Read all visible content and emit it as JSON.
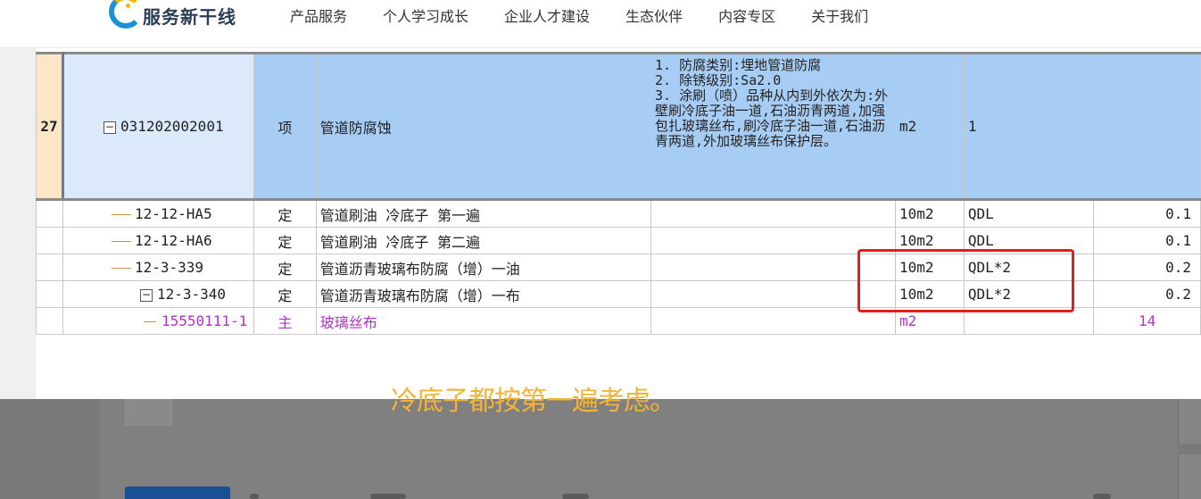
{
  "nav": {
    "logo_text": "服务新干线",
    "menu": [
      "产品服务",
      "个人学习成长",
      "企业人才建设",
      "生态伙伴",
      "内容专区",
      "关于我们"
    ]
  },
  "table": {
    "selected_row": {
      "row_no": "27",
      "code": "031202002001",
      "type": "项",
      "name": "管道防腐蚀",
      "features": "1. 防腐类别:埋地管道防腐\n2. 除锈级别:Sa2.0\n3. 涂刷（喷）品种从内到外依次为:外壁刷冷底子油一道,石油沥青两道,加强包扎玻璃丝布,刷冷底子油一道,石油沥青两道,外加玻璃丝布保护层。",
      "unit": "m2",
      "quantity_expr": "1"
    },
    "rows": [
      {
        "code": "12-12-HA5",
        "type": "定",
        "name": "管道刷油 冷底子 第一遍",
        "unit": "10m2",
        "expr": "QDL",
        "qty": "0.1"
      },
      {
        "code": "12-12-HA6",
        "type": "定",
        "name": "管道刷油 冷底子 第二遍",
        "unit": "10m2",
        "expr": "QDL",
        "qty": "0.1"
      },
      {
        "code": "12-3-339",
        "type": "定",
        "name": "管道沥青玻璃布防腐（增）一油",
        "unit": "10m2",
        "expr": "QDL*2",
        "qty": "0.2"
      },
      {
        "code": "12-3-340",
        "type": "定",
        "name": "管道沥青玻璃布防腐（增）一布",
        "unit": "10m2",
        "expr": "QDL*2",
        "qty": "0.2"
      }
    ],
    "material_row": {
      "code": "15550111-1",
      "type": "主",
      "name": "玻璃丝布",
      "unit": "m2",
      "expr": "",
      "qty": "14"
    }
  },
  "subtitle": "冷底子都按第一遍考虑。",
  "colors": {
    "selected_bg": "#a8cdf5",
    "highlight": "#e81c1c",
    "material_text": "#b032c8",
    "subtitle": "#f5b335"
  }
}
